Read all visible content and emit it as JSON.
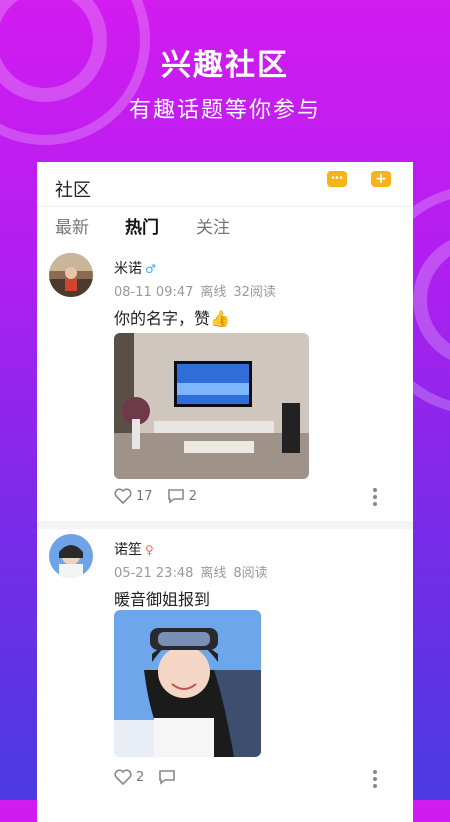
{
  "hero": {
    "title": "兴趣社区",
    "subtitle": "有趣话题等你参与"
  },
  "header": {
    "title": "社区",
    "chat_icon": "chat-bubble-icon",
    "add_icon": "plus-icon"
  },
  "tabs": [
    {
      "label": "最新",
      "active": false
    },
    {
      "label": "热门",
      "active": true
    },
    {
      "label": "关注",
      "active": false
    }
  ],
  "posts": [
    {
      "username": "米诺",
      "gender_icon": "male-icon",
      "gender_color": "#4aa8f0",
      "date": "08-11 09:47",
      "status": "离线",
      "reads": "32阅读",
      "text": "你的名字，赞👍",
      "likes": "17",
      "comments": "2"
    },
    {
      "username": "诺笙",
      "gender_icon": "female-icon",
      "gender_color": "#f06a6a",
      "date": "05-21 23:48",
      "status": "离线",
      "reads": "8阅读",
      "text": "暖音御姐报到",
      "likes": "2",
      "comments": ""
    }
  ],
  "colors": {
    "accent": "#f7b21c",
    "bg_top": "#d21cf0",
    "bg_bottom": "#4b3be0"
  }
}
